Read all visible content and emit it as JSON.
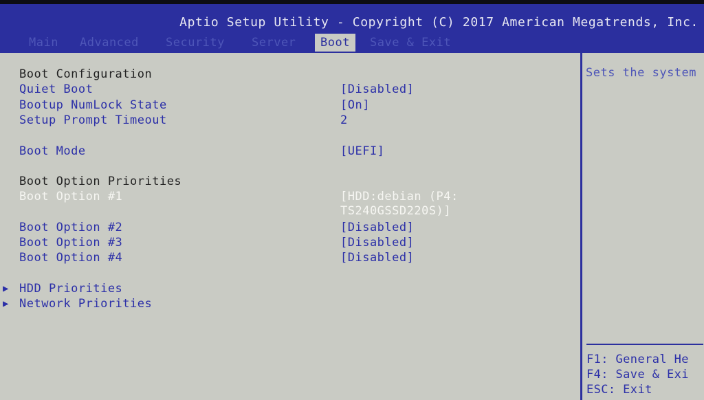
{
  "header": {
    "title": "Aptio Setup Utility - Copyright (C) 2017 American Megatrends, Inc."
  },
  "tabs": [
    {
      "label": "Main",
      "active": false
    },
    {
      "label": "Advanced",
      "active": false
    },
    {
      "label": "Security",
      "active": false
    },
    {
      "label": "Server",
      "active": false
    },
    {
      "label": "Boot",
      "active": true
    },
    {
      "label": "Save & Exit",
      "active": false
    }
  ],
  "boot_config": {
    "section_heading": "Boot Configuration",
    "quiet_boot": {
      "label": "Quiet Boot",
      "value": "[Disabled]"
    },
    "numlock": {
      "label": "Bootup NumLock State",
      "value": "[On]"
    },
    "prompt_timeout": {
      "label": "Setup Prompt Timeout",
      "value": "2"
    },
    "boot_mode": {
      "label": "Boot Mode",
      "value": "[UEFI]"
    }
  },
  "priorities": {
    "section_heading": "Boot Option Priorities",
    "option1": {
      "label": "Boot Option #1",
      "value_line1": "[HDD:debian (P4:",
      "value_line2": "TS240GSSD220S)]"
    },
    "option2": {
      "label": "Boot Option #2",
      "value": "[Disabled]"
    },
    "option3": {
      "label": "Boot Option #3",
      "value": "[Disabled]"
    },
    "option4": {
      "label": "Boot Option #4",
      "value": "[Disabled]"
    }
  },
  "submenus": [
    {
      "label": "HDD Priorities",
      "icon": "triangle-right-icon"
    },
    {
      "label": "Network Priorities",
      "icon": "triangle-right-icon"
    }
  ],
  "help": {
    "description": "Sets the system",
    "keys": [
      "F1: General He",
      "F4: Save & Exi",
      "ESC: Exit"
    ]
  },
  "colors": {
    "frame_blue": "#2b2f9e",
    "panel_gray": "#c9cbc4",
    "item_blue": "#2b2fa8",
    "selected_white": "#f6f6f2"
  }
}
